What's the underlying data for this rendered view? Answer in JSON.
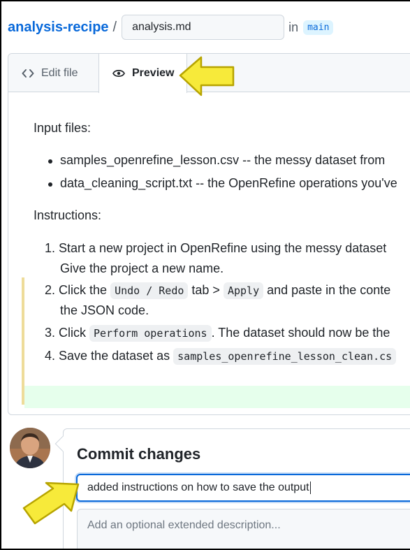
{
  "breadcrumb": {
    "repo": "analysis-recipe",
    "separator": "/",
    "filename_value": "analysis.md",
    "in_text": "in",
    "branch": "main"
  },
  "tabs": {
    "edit_label": "Edit file",
    "preview_label": "Preview",
    "edit_icon": "code-icon",
    "preview_icon": "eye-icon"
  },
  "preview": {
    "input_files_heading": "Input files:",
    "input_files": [
      "samples_openrefine_lesson.csv -- the messy dataset from",
      "data_cleaning_script.txt -- the OpenRefine operations you've"
    ],
    "instructions_heading": "Instructions:",
    "steps": [
      {
        "number": "1.",
        "line1": "Start a new project in OpenRefine using the messy dataset",
        "line2": "Give the project a new name."
      },
      {
        "number": "2.",
        "text_a": "Click the ",
        "code_a": "Undo / Redo",
        "text_b": " tab > ",
        "code_b": "Apply",
        "text_c": " and paste in the conte",
        "line2": "the JSON code."
      },
      {
        "number": "3.",
        "text_a": "Click ",
        "code_a": "Perform operations",
        "text_b": ". The dataset should now be the"
      },
      {
        "number": "4.",
        "text_a": "Save the dataset as ",
        "code_a": "samples_openrefine_lesson_clean.cs"
      }
    ]
  },
  "commit": {
    "title": "Commit changes",
    "message_value": "added instructions on how to save the output",
    "description_placeholder": "Add an optional extended description..."
  },
  "colors": {
    "link_blue": "#0969da",
    "added_line_bg": "#e6ffec",
    "change_bar": "#eedc9a",
    "annotation_arrow": "#f7ea3a"
  }
}
